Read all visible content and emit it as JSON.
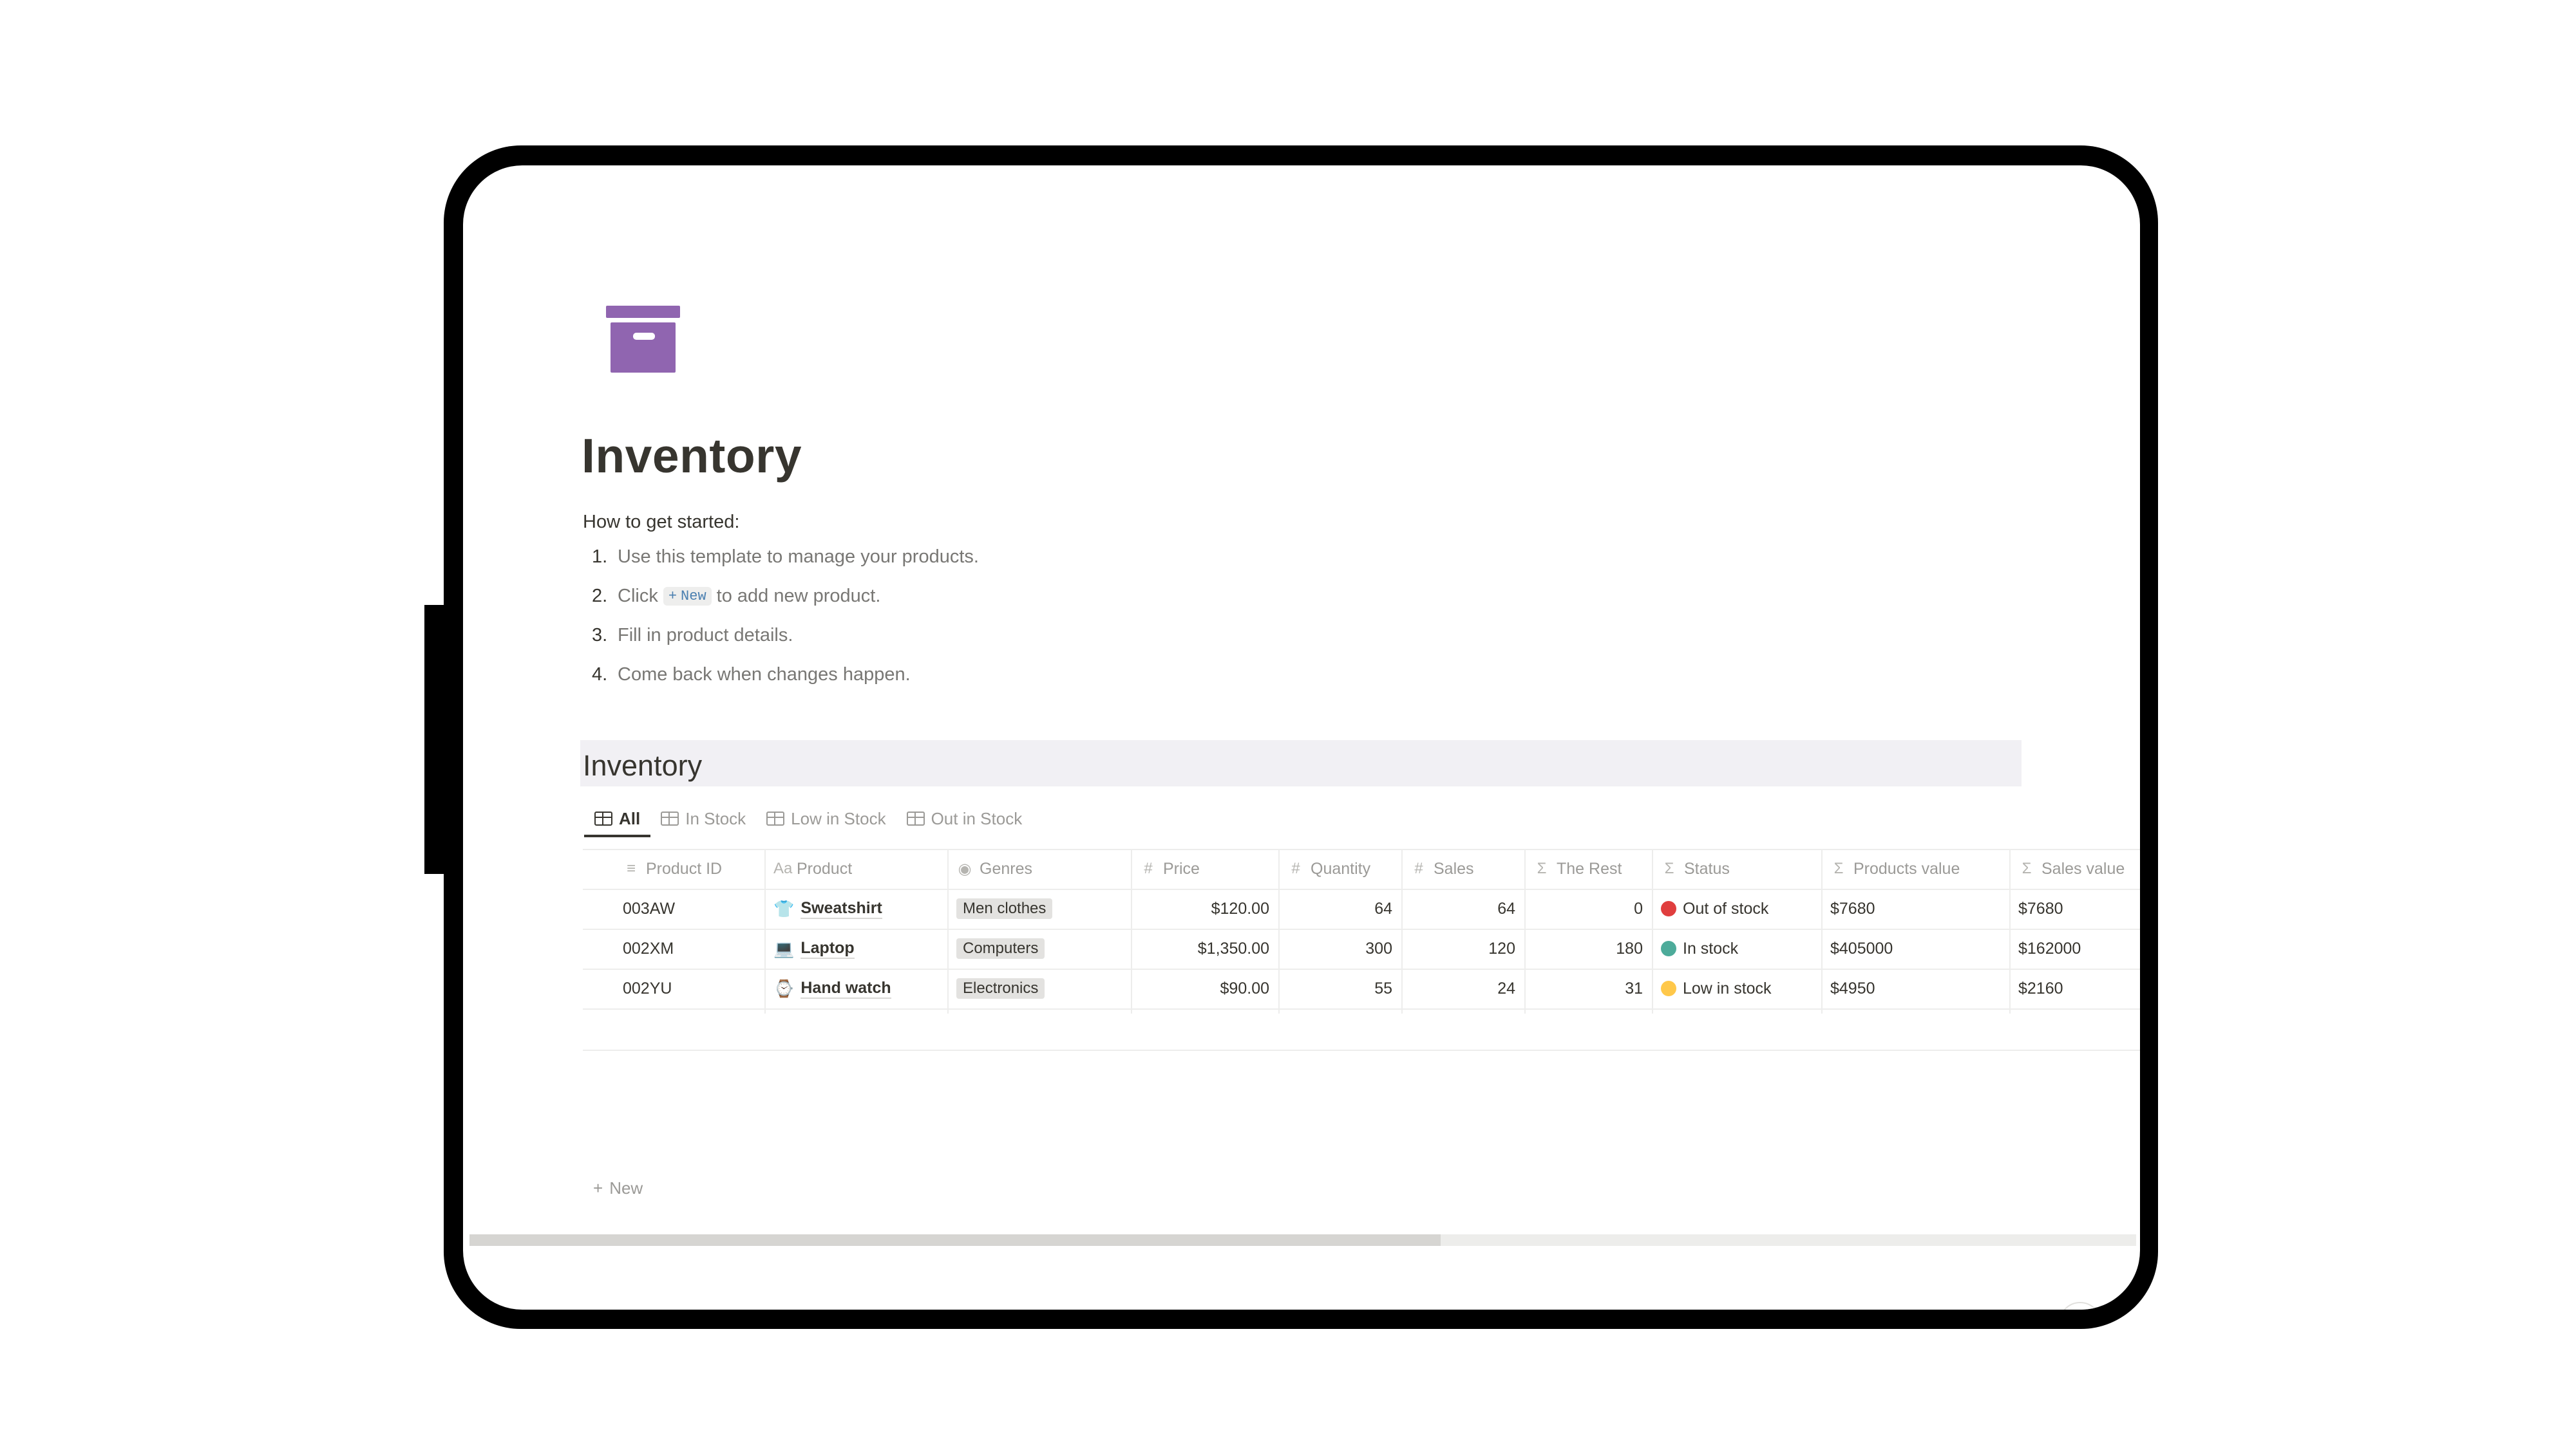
{
  "page": {
    "icon": "archive-box-icon",
    "title": "Inventory",
    "intro_heading": "How to get started:",
    "steps": [
      {
        "num": "1.",
        "text": "Use this template to manage your products."
      },
      {
        "num": "2.",
        "pre": "Click",
        "chip_label": "New",
        "post": "to add new product."
      },
      {
        "num": "3.",
        "text": "Fill in product details."
      },
      {
        "num": "4.",
        "text": "Come back when changes happen."
      }
    ]
  },
  "database": {
    "title": "Inventory",
    "tabs": [
      {
        "label": "All",
        "active": true
      },
      {
        "label": "In Stock",
        "active": false
      },
      {
        "label": "Low in Stock",
        "active": false
      },
      {
        "label": "Out in Stock",
        "active": false
      }
    ],
    "columns": [
      {
        "label": "Product ID",
        "icon": "text-lines-icon",
        "glyph": "≡"
      },
      {
        "label": "Product",
        "icon": "title-icon",
        "glyph": "Aa"
      },
      {
        "label": "Genres",
        "icon": "select-icon",
        "glyph": "◉"
      },
      {
        "label": "Price",
        "icon": "number-icon",
        "glyph": "#"
      },
      {
        "label": "Quantity",
        "icon": "number-icon",
        "glyph": "#"
      },
      {
        "label": "Sales",
        "icon": "number-icon",
        "glyph": "#"
      },
      {
        "label": "The Rest",
        "icon": "formula-icon",
        "glyph": "Σ"
      },
      {
        "label": "Status",
        "icon": "formula-icon",
        "glyph": "Σ"
      },
      {
        "label": "Products value",
        "icon": "formula-icon",
        "glyph": "Σ"
      },
      {
        "label": "Sales value",
        "icon": "formula-icon",
        "glyph": "Σ"
      }
    ],
    "rows": [
      {
        "product_id": "003AW",
        "product": "Sweatshirt",
        "product_icon": "tshirt-icon",
        "product_glyph": "👕",
        "genre": "Men clothes",
        "price": "$120.00",
        "quantity": "64",
        "sales": "64",
        "rest": "0",
        "status": "Out of stock",
        "status_color": "#e03e3e",
        "products_value": "$7680",
        "sales_value": "$7680"
      },
      {
        "product_id": "002XM",
        "product": "Laptop",
        "product_icon": "laptop-icon",
        "product_glyph": "💻",
        "genre": "Computers",
        "price": "$1,350.00",
        "quantity": "300",
        "sales": "120",
        "rest": "180",
        "status": "In stock",
        "status_color": "#4dab9a",
        "products_value": "$405000",
        "sales_value": "$162000"
      },
      {
        "product_id": "002YU",
        "product": "Hand watch",
        "product_icon": "watch-icon",
        "product_glyph": "⌚",
        "genre": "Electronics",
        "price": "$90.00",
        "quantity": "55",
        "sales": "24",
        "rest": "31",
        "status": "Low in stock",
        "status_color": "#ffc84a",
        "products_value": "$4950",
        "sales_value": "$2160"
      }
    ],
    "new_label": "New"
  },
  "help_label": "?",
  "colors": {
    "accent": "#9065b0"
  }
}
